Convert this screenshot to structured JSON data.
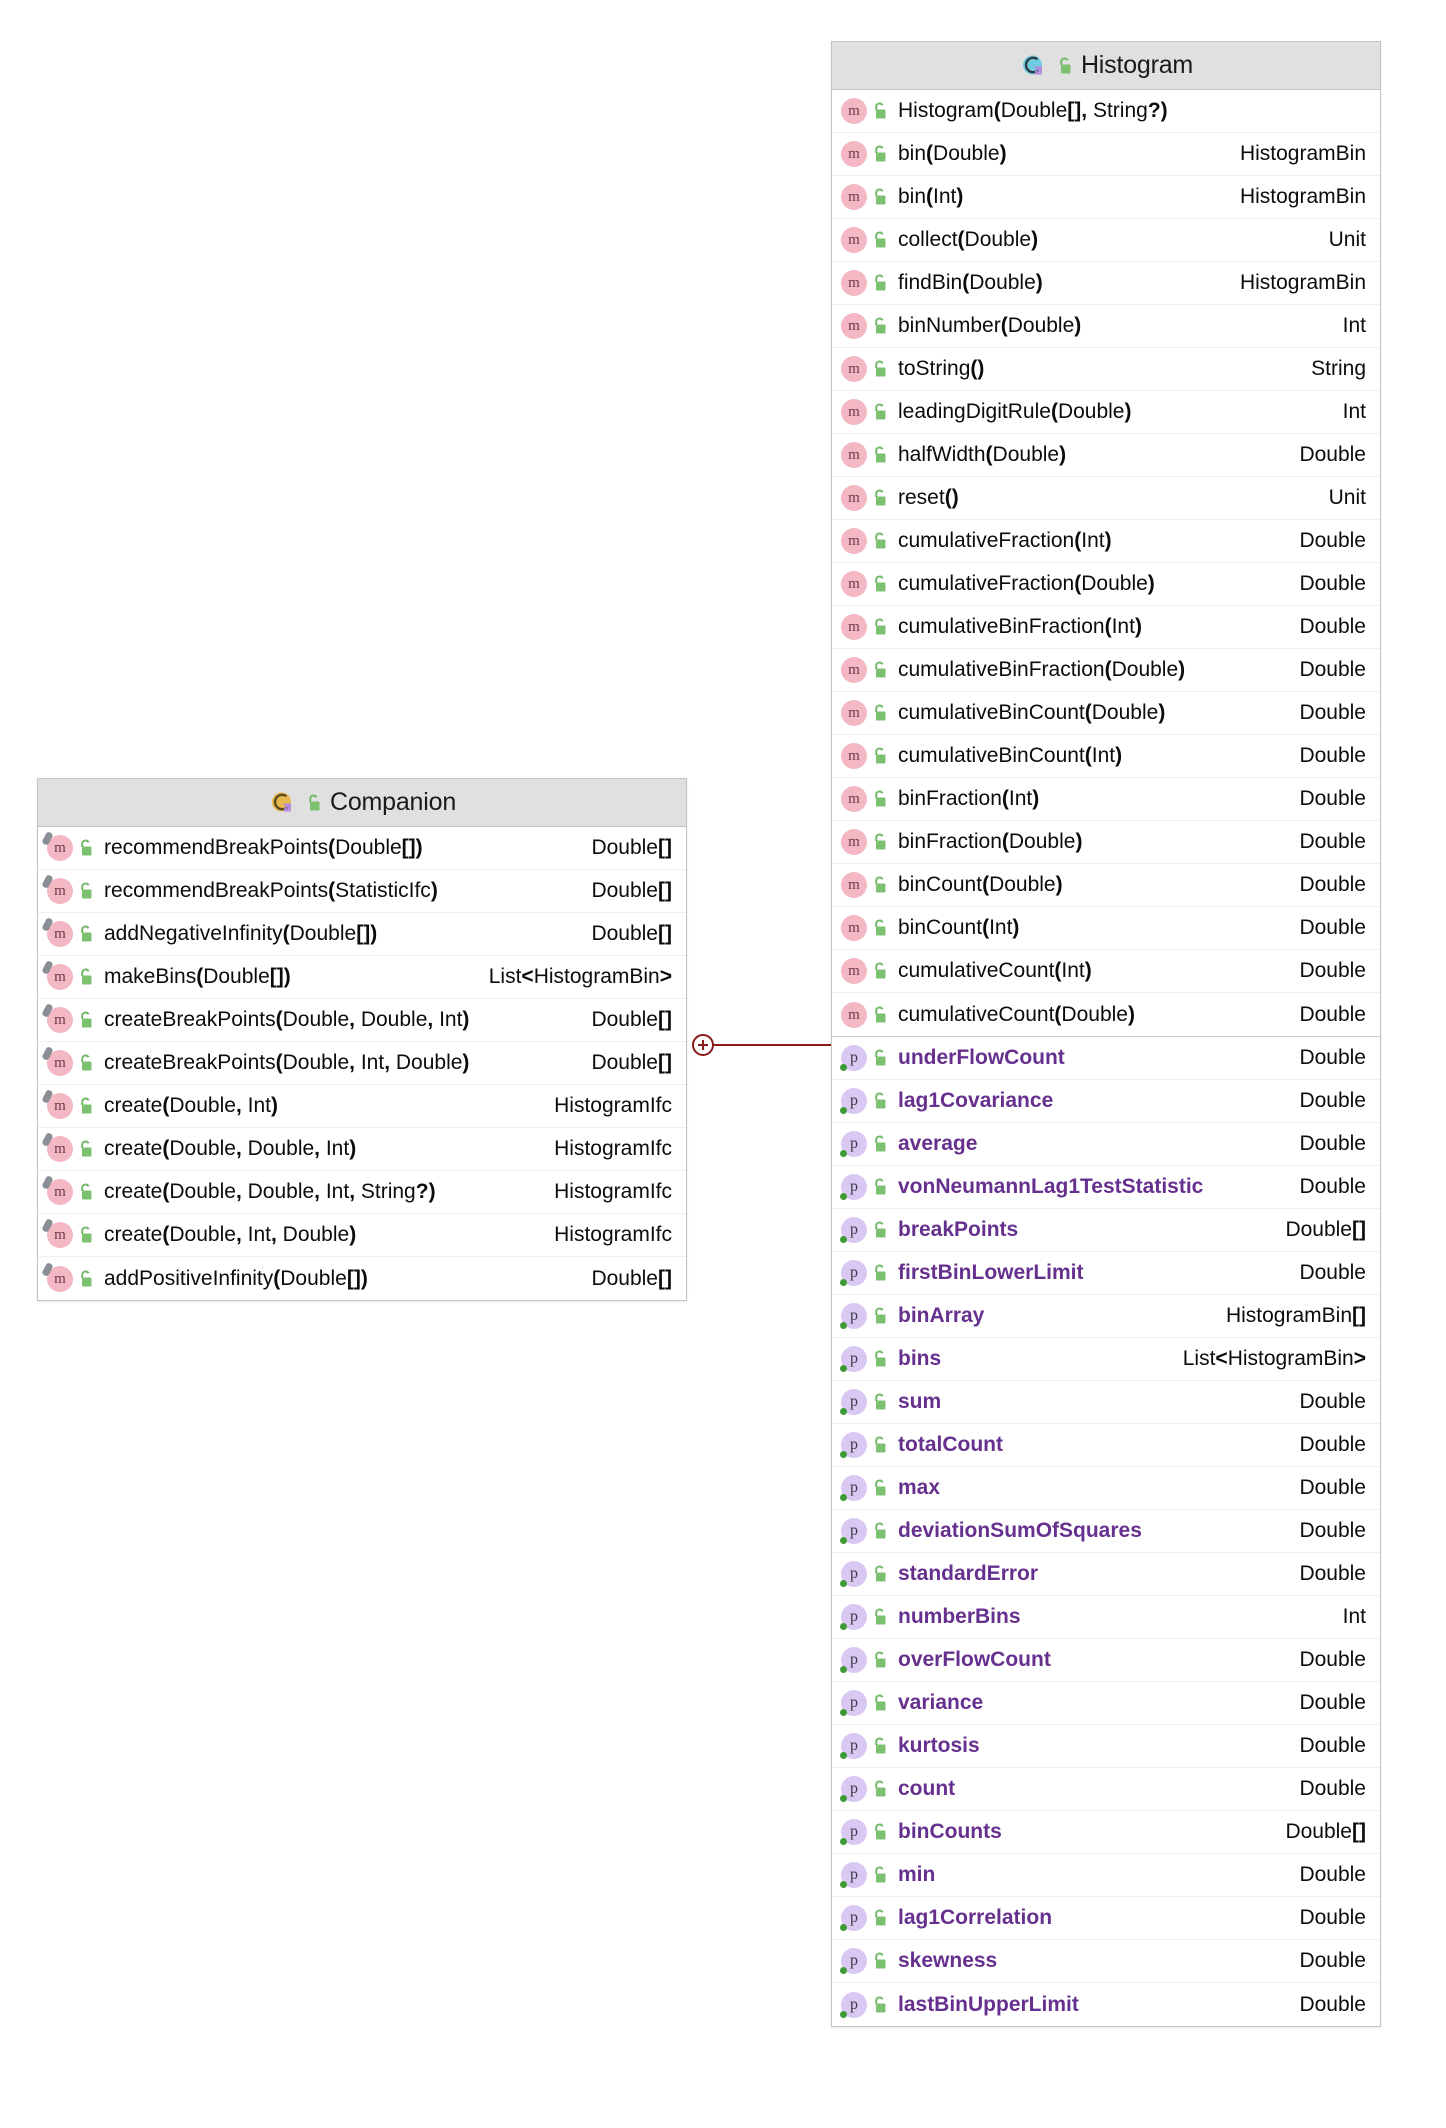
{
  "diagram": {
    "type": "uml-class-diagram",
    "connector": {
      "kind": "nested-class-link",
      "marker": "plus-circle",
      "color": "#8b1a1a"
    }
  },
  "classes": [
    {
      "id": "histogram",
      "title": "Histogram",
      "icon": "kotlin-class-icon",
      "icon_color": "#6ecbe0",
      "visibility_icon": "unlocked-padlock-icon",
      "sections": [
        {
          "kind": "methods",
          "members": [
            {
              "icon": "method-icon",
              "name": "Histogram",
              "params": "(Double[], String?)",
              "type": ""
            },
            {
              "icon": "method-icon",
              "name": "bin",
              "params": "(Double)",
              "type": "HistogramBin"
            },
            {
              "icon": "method-icon",
              "name": "bin",
              "params": "(Int)",
              "type": "HistogramBin"
            },
            {
              "icon": "method-icon",
              "name": "collect",
              "params": "(Double)",
              "type": "Unit"
            },
            {
              "icon": "method-icon",
              "name": "findBin",
              "params": "(Double)",
              "type": "HistogramBin"
            },
            {
              "icon": "method-icon",
              "name": "binNumber",
              "params": "(Double)",
              "type": "Int"
            },
            {
              "icon": "method-icon",
              "name": "toString",
              "params": "()",
              "type": "String"
            },
            {
              "icon": "method-icon",
              "name": "leadingDigitRule",
              "params": "(Double)",
              "type": "Int"
            },
            {
              "icon": "method-icon",
              "name": "halfWidth",
              "params": "(Double)",
              "type": "Double"
            },
            {
              "icon": "method-icon",
              "name": "reset",
              "params": "()",
              "type": "Unit"
            },
            {
              "icon": "method-icon",
              "name": "cumulativeFraction",
              "params": "(Int)",
              "type": "Double"
            },
            {
              "icon": "method-icon",
              "name": "cumulativeFraction",
              "params": "(Double)",
              "type": "Double"
            },
            {
              "icon": "method-icon",
              "name": "cumulativeBinFraction",
              "params": "(Int)",
              "type": "Double"
            },
            {
              "icon": "method-icon",
              "name": "cumulativeBinFraction",
              "params": "(Double)",
              "type": "Double"
            },
            {
              "icon": "method-icon",
              "name": "cumulativeBinCount",
              "params": "(Double)",
              "type": "Double"
            },
            {
              "icon": "method-icon",
              "name": "cumulativeBinCount",
              "params": "(Int)",
              "type": "Double"
            },
            {
              "icon": "method-icon",
              "name": "binFraction",
              "params": "(Int)",
              "type": "Double"
            },
            {
              "icon": "method-icon",
              "name": "binFraction",
              "params": "(Double)",
              "type": "Double"
            },
            {
              "icon": "method-icon",
              "name": "binCount",
              "params": "(Double)",
              "type": "Double"
            },
            {
              "icon": "method-icon",
              "name": "binCount",
              "params": "(Int)",
              "type": "Double"
            },
            {
              "icon": "method-icon",
              "name": "cumulativeCount",
              "params": "(Int)",
              "type": "Double"
            },
            {
              "icon": "method-icon",
              "name": "cumulativeCount",
              "params": "(Double)",
              "type": "Double"
            }
          ]
        },
        {
          "kind": "properties",
          "members": [
            {
              "icon": "property-icon",
              "name": "underFlowCount",
              "params": "",
              "type": "Double"
            },
            {
              "icon": "property-icon",
              "name": "lag1Covariance",
              "params": "",
              "type": "Double"
            },
            {
              "icon": "property-icon",
              "name": "average",
              "params": "",
              "type": "Double"
            },
            {
              "icon": "property-icon",
              "name": "vonNeumannLag1TestStatistic",
              "params": "",
              "type": "Double"
            },
            {
              "icon": "property-icon",
              "name": "breakPoints",
              "params": "",
              "type": "Double[]"
            },
            {
              "icon": "property-icon",
              "name": "firstBinLowerLimit",
              "params": "",
              "type": "Double"
            },
            {
              "icon": "property-icon",
              "name": "binArray",
              "params": "",
              "type": "HistogramBin[]"
            },
            {
              "icon": "property-icon",
              "name": "bins",
              "params": "",
              "type": "List<HistogramBin>"
            },
            {
              "icon": "property-icon",
              "name": "sum",
              "params": "",
              "type": "Double"
            },
            {
              "icon": "property-icon",
              "name": "totalCount",
              "params": "",
              "type": "Double"
            },
            {
              "icon": "property-icon",
              "name": "max",
              "params": "",
              "type": "Double"
            },
            {
              "icon": "property-icon",
              "name": "deviationSumOfSquares",
              "params": "",
              "type": "Double"
            },
            {
              "icon": "property-icon",
              "name": "standardError",
              "params": "",
              "type": "Double"
            },
            {
              "icon": "property-icon",
              "name": "numberBins",
              "params": "",
              "type": "Int"
            },
            {
              "icon": "property-icon",
              "name": "overFlowCount",
              "params": "",
              "type": "Double"
            },
            {
              "icon": "property-icon",
              "name": "variance",
              "params": "",
              "type": "Double"
            },
            {
              "icon": "property-icon",
              "name": "kurtosis",
              "params": "",
              "type": "Double"
            },
            {
              "icon": "property-icon",
              "name": "count",
              "params": "",
              "type": "Double"
            },
            {
              "icon": "property-icon",
              "name": "binCounts",
              "params": "",
              "type": "Double[]"
            },
            {
              "icon": "property-icon",
              "name": "min",
              "params": "",
              "type": "Double"
            },
            {
              "icon": "property-icon",
              "name": "lag1Correlation",
              "params": "",
              "type": "Double"
            },
            {
              "icon": "property-icon",
              "name": "skewness",
              "params": "",
              "type": "Double"
            },
            {
              "icon": "property-icon",
              "name": "lastBinUpperLimit",
              "params": "",
              "type": "Double"
            }
          ]
        }
      ]
    },
    {
      "id": "companion",
      "title": "Companion",
      "icon": "kotlin-companion-object-icon",
      "icon_color": "#e8b84b",
      "visibility_icon": "unlocked-padlock-icon",
      "sections": [
        {
          "kind": "methods",
          "members": [
            {
              "icon": "static-method-icon",
              "name": "recommendBreakPoints",
              "params": "(Double[])",
              "type": "Double[]"
            },
            {
              "icon": "static-method-icon",
              "name": "recommendBreakPoints",
              "params": "(StatisticIfc)",
              "type": "Double[]"
            },
            {
              "icon": "static-method-icon",
              "name": "addNegativeInfinity",
              "params": "(Double[])",
              "type": "Double[]"
            },
            {
              "icon": "static-method-icon",
              "name": "makeBins",
              "params": "(Double[])",
              "type": "List<HistogramBin>"
            },
            {
              "icon": "static-method-icon",
              "name": "createBreakPoints",
              "params": "(Double, Double, Int)",
              "type": "Double[]"
            },
            {
              "icon": "static-method-icon",
              "name": "createBreakPoints",
              "params": "(Double, Int, Double)",
              "type": "Double[]"
            },
            {
              "icon": "static-method-icon",
              "name": "create",
              "params": "(Double, Int)",
              "type": "HistogramIfc"
            },
            {
              "icon": "static-method-icon",
              "name": "create",
              "params": "(Double, Double, Int)",
              "type": "HistogramIfc"
            },
            {
              "icon": "static-method-icon",
              "name": "create",
              "params": "(Double, Double, Int, String?)",
              "type": "HistogramIfc"
            },
            {
              "icon": "static-method-icon",
              "name": "create",
              "params": "(Double, Int, Double)",
              "type": "HistogramIfc"
            },
            {
              "icon": "static-method-icon",
              "name": "addPositiveInfinity",
              "params": "(Double[])",
              "type": "Double[]"
            }
          ]
        }
      ]
    }
  ]
}
